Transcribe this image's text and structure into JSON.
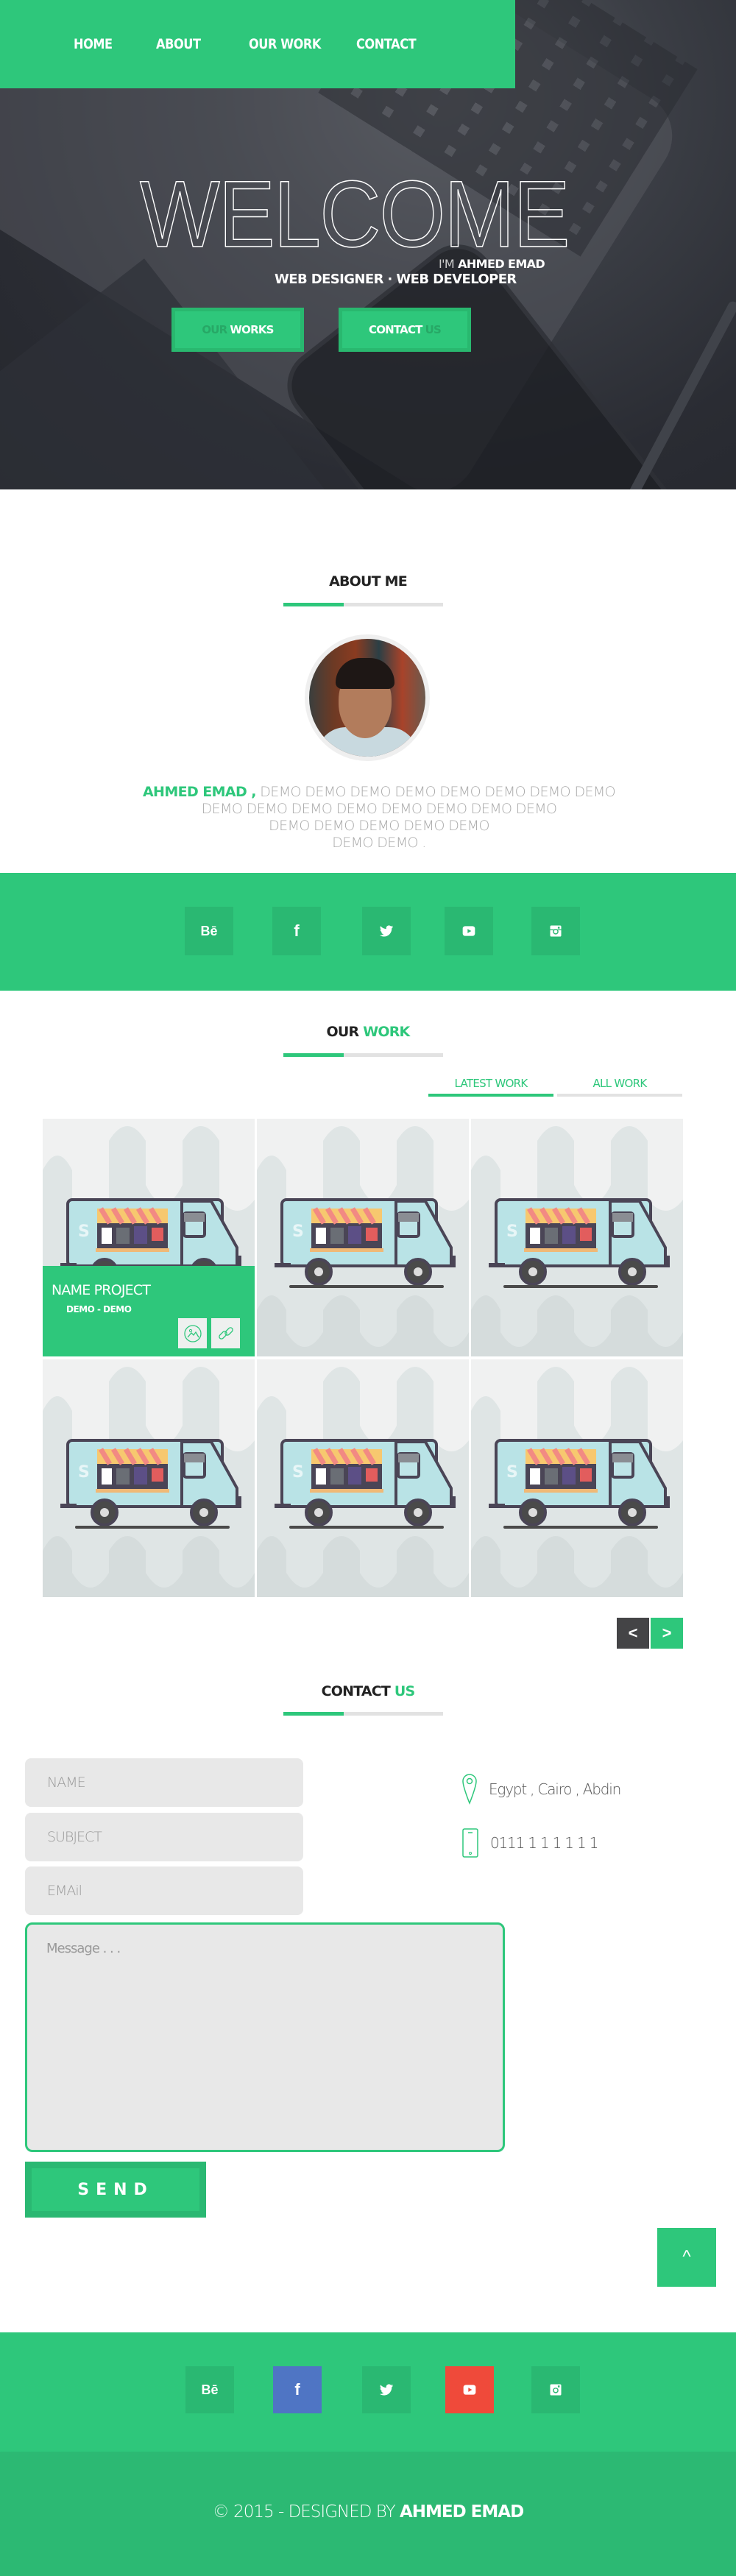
{
  "nav": {
    "items": [
      {
        "label": "HOME"
      },
      {
        "label": "ABOUT"
      },
      {
        "label": "OUR WORK"
      },
      {
        "label": "CONTACT"
      }
    ]
  },
  "hero": {
    "title": "WELCOME",
    "intro_prefix": "I'M",
    "intro_name": "AHMED EMAD",
    "roles": "WEB DESIGNER · WEB DEVELOPER",
    "buttons": [
      {
        "dim": "OUR",
        "main": "WORKS"
      },
      {
        "main": "CONTACT",
        "dim": "US"
      }
    ]
  },
  "about": {
    "title": "ABOUT ME",
    "bio_name": "AHMED EMAD ,",
    "bio_lines": [
      "DEMO DEMO DEMO DEMO DEMO DEMO DEMO DEMO",
      "DEMO DEMO DEMO DEMO DEMO DEMO DEMO DEMO",
      "DEMO DEMO DEMO DEMO DEMO",
      "DEMO DEMO ."
    ]
  },
  "social": {
    "items": [
      {
        "label": "Bē",
        "icon": "behance-icon"
      },
      {
        "label": "f",
        "icon": "facebook-icon"
      },
      {
        "label": "",
        "icon": "twitter-icon"
      },
      {
        "label": "",
        "icon": "youtube-icon"
      },
      {
        "label": "",
        "icon": "instagram-icon"
      }
    ],
    "footer_colors": {
      "facebook": "#4f75c4",
      "youtube": "#ef4a3a"
    }
  },
  "work": {
    "title_a": "OUR",
    "title_b": "WORK",
    "tabs": [
      {
        "label": "LATEST WORK",
        "active": true
      },
      {
        "label": "ALL WORK",
        "active": false
      }
    ],
    "projects": [
      {
        "name": "NAME PROJECT",
        "tags": "DEMO - DEMO",
        "image": "food-truck-illustration"
      },
      {
        "image": "food-truck-illustration"
      },
      {
        "image": "food-truck-illustration"
      },
      {
        "image": "food-truck-illustration"
      },
      {
        "image": "food-truck-illustration"
      },
      {
        "image": "food-truck-illustration"
      }
    ],
    "prev_label": "<",
    "next_label": ">"
  },
  "contact": {
    "title_a": "CONTACT",
    "title_b": "US",
    "fields": {
      "name_placeholder": "NAME",
      "subject_placeholder": "SUBJECT",
      "email_placeholder": "EMAil",
      "message_placeholder": "Message . . ."
    },
    "send_label": "SEND",
    "address": "Egypt , Cairo , Abdin",
    "phone": "0111 1 1 1 1 1 1"
  },
  "back_to_top_label": "^",
  "footer": {
    "copyright_prefix": "© 2015 -  DESIGNED BY",
    "author": "AHMED EMAD"
  },
  "colors": {
    "accent": "#2ec77b",
    "accent_dark": "#2ab872",
    "dark_btn": "#444446"
  }
}
